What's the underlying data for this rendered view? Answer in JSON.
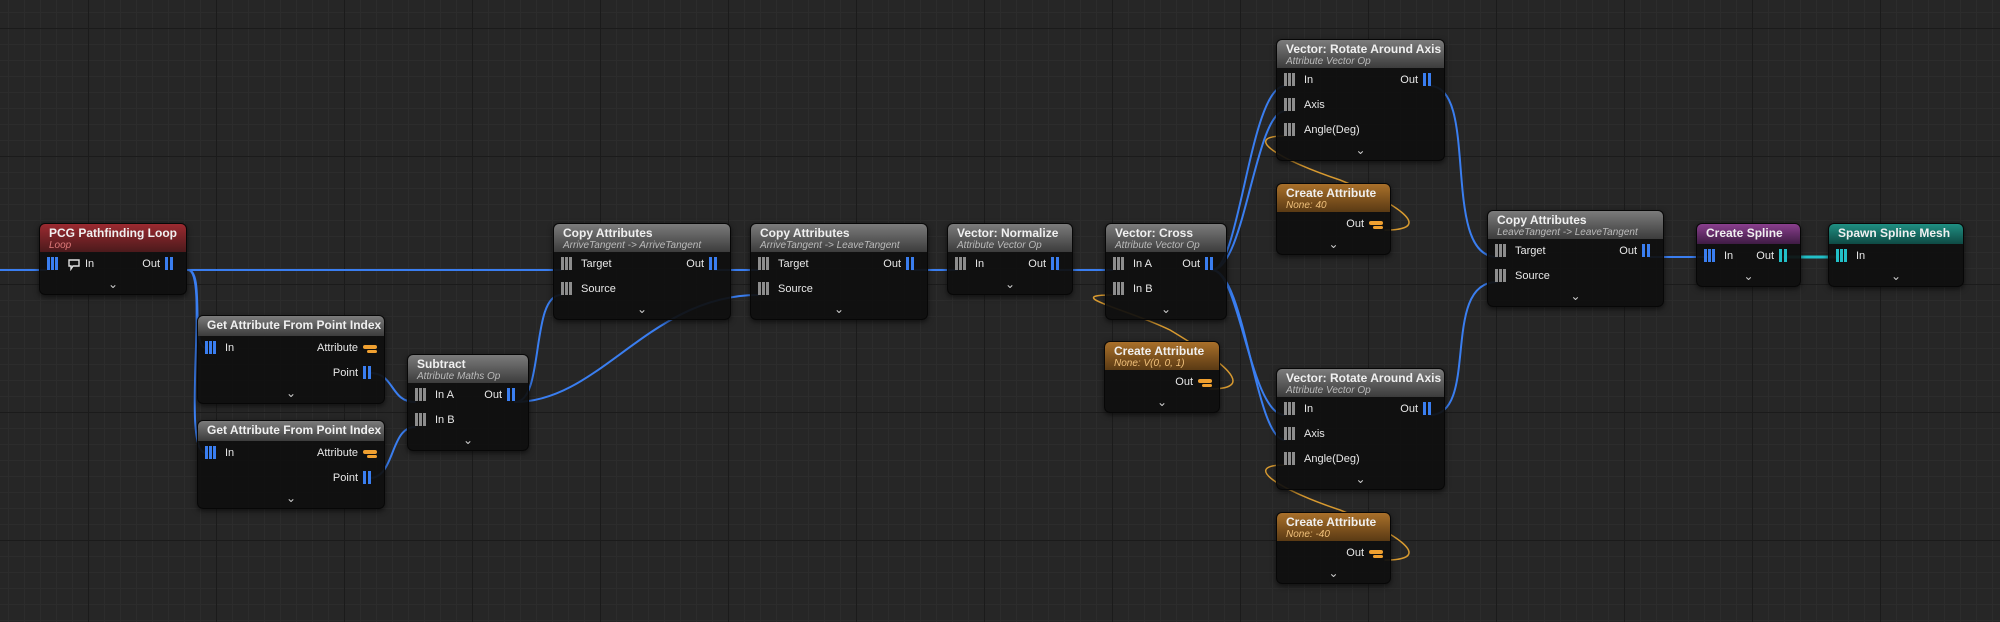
{
  "nodes": {
    "pathfinding_loop": {
      "title": "PCG Pathfinding Loop",
      "subtitle": "Loop",
      "in": "In",
      "out": "Out"
    },
    "get_attr_1": {
      "title": "Get Attribute From Point Index",
      "in": "In",
      "out_attribute": "Attribute",
      "out_point": "Point"
    },
    "get_attr_2": {
      "title": "Get Attribute From Point Index",
      "in": "In",
      "out_attribute": "Attribute",
      "out_point": "Point"
    },
    "subtract": {
      "title": "Subtract",
      "subtitle": "Attribute Maths Op",
      "in_a": "In A",
      "in_b": "In B",
      "out": "Out"
    },
    "copy_attr_1": {
      "title": "Copy Attributes",
      "subtitle": "ArriveTangent -> ArriveTangent",
      "target": "Target",
      "source": "Source",
      "out": "Out"
    },
    "copy_attr_2": {
      "title": "Copy Attributes",
      "subtitle": "ArriveTangent -> LeaveTangent",
      "target": "Target",
      "source": "Source",
      "out": "Out"
    },
    "normalize": {
      "title": "Vector: Normalize",
      "subtitle": "Attribute Vector Op",
      "in": "In",
      "out": "Out"
    },
    "cross": {
      "title": "Vector: Cross",
      "subtitle": "Attribute Vector Op",
      "in_a": "In A",
      "in_b": "In B",
      "out": "Out"
    },
    "create_attr_cross": {
      "title": "Create Attribute",
      "subtitle": "None: V(0, 0, 1)",
      "out": "Out"
    },
    "rotate_1": {
      "title": "Vector: Rotate Around Axis",
      "subtitle": "Attribute Vector Op",
      "in": "In",
      "axis": "Axis",
      "angle": "Angle(Deg)",
      "out": "Out"
    },
    "create_attr_40": {
      "title": "Create Attribute",
      "subtitle": "None: 40",
      "out": "Out"
    },
    "rotate_2": {
      "title": "Vector: Rotate Around Axis",
      "subtitle": "Attribute Vector Op",
      "in": "In",
      "axis": "Axis",
      "angle": "Angle(Deg)",
      "out": "Out"
    },
    "create_attr_m40": {
      "title": "Create Attribute",
      "subtitle": "None: -40",
      "out": "Out"
    },
    "copy_attr_3": {
      "title": "Copy Attributes",
      "subtitle": "LeaveTangent -> LeaveTangent",
      "target": "Target",
      "source": "Source",
      "out": "Out"
    },
    "create_spline": {
      "title": "Create Spline",
      "in": "In",
      "out": "Out"
    },
    "spawn_spline_mesh": {
      "title": "Spawn Spline Mesh",
      "in": "In"
    }
  },
  "icons": {
    "expand": "chevron-down-icon",
    "loop": "loop-icon",
    "pin_data": "data-pin-icon",
    "pin_attribute": "attribute-pin-icon"
  },
  "colors": {
    "wire_blue": "#3a7ef0",
    "wire_orange": "#d89a30",
    "wire_teal": "#22c0c8",
    "header_red": "#9b2a30",
    "header_orange": "#a9702a",
    "header_purple": "#8a3f8e",
    "header_teal": "#1f8f82",
    "header_grey": "#6a6a6a"
  }
}
